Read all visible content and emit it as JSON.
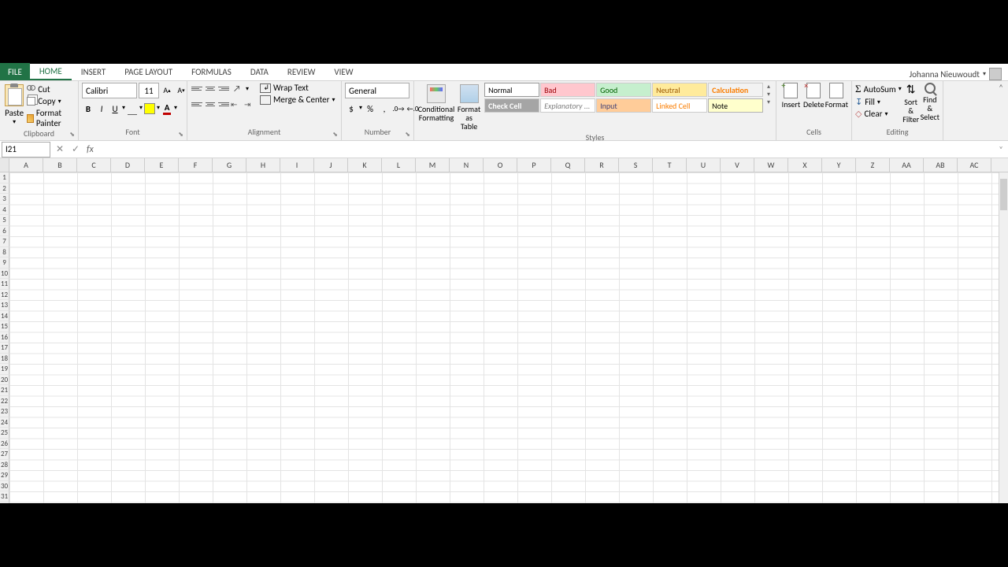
{
  "user": {
    "name": "Johanna Nieuwoudt"
  },
  "tabs": {
    "file": "FILE",
    "items": [
      "HOME",
      "INSERT",
      "PAGE LAYOUT",
      "FORMULAS",
      "DATA",
      "REVIEW",
      "VIEW"
    ],
    "active": "HOME"
  },
  "clipboard": {
    "group": "Clipboard",
    "paste": "Paste",
    "cut": "Cut",
    "copy": "Copy",
    "format_painter": "Format Painter"
  },
  "font": {
    "group": "Font",
    "name": "Calibri",
    "size": "11",
    "bold": "B",
    "italic": "I",
    "underline": "U",
    "font_color_letter": "A"
  },
  "alignment": {
    "group": "Alignment",
    "wrap": "Wrap Text",
    "merge": "Merge & Center"
  },
  "number": {
    "group": "Number",
    "format": "General"
  },
  "styles": {
    "group": "Styles",
    "cond_fmt": "Conditional Formatting",
    "fmt_table": "Format as Table",
    "gallery": [
      [
        "Normal",
        "Bad",
        "Good",
        "Neutral",
        "Calculation"
      ],
      [
        "Check Cell",
        "Explanatory ...",
        "Input",
        "Linked Cell",
        "Note"
      ]
    ]
  },
  "cells": {
    "group": "Cells",
    "insert": "Insert",
    "delete": "Delete",
    "format": "Format"
  },
  "editing": {
    "group": "Editing",
    "autosum": "AutoSum",
    "fill": "Fill",
    "clear": "Clear",
    "sort": "Sort & Filter",
    "find": "Find & Select"
  },
  "formula_bar": {
    "name_box": "I21",
    "fx": "fx",
    "value": ""
  },
  "grid": {
    "cols": [
      "A",
      "B",
      "C",
      "D",
      "E",
      "F",
      "G",
      "H",
      "I",
      "J",
      "K",
      "L",
      "M",
      "N",
      "O",
      "P",
      "Q",
      "R",
      "S",
      "T",
      "U",
      "V",
      "W",
      "X",
      "Y",
      "Z",
      "AA",
      "AB",
      "AC"
    ],
    "row_count": 32
  }
}
